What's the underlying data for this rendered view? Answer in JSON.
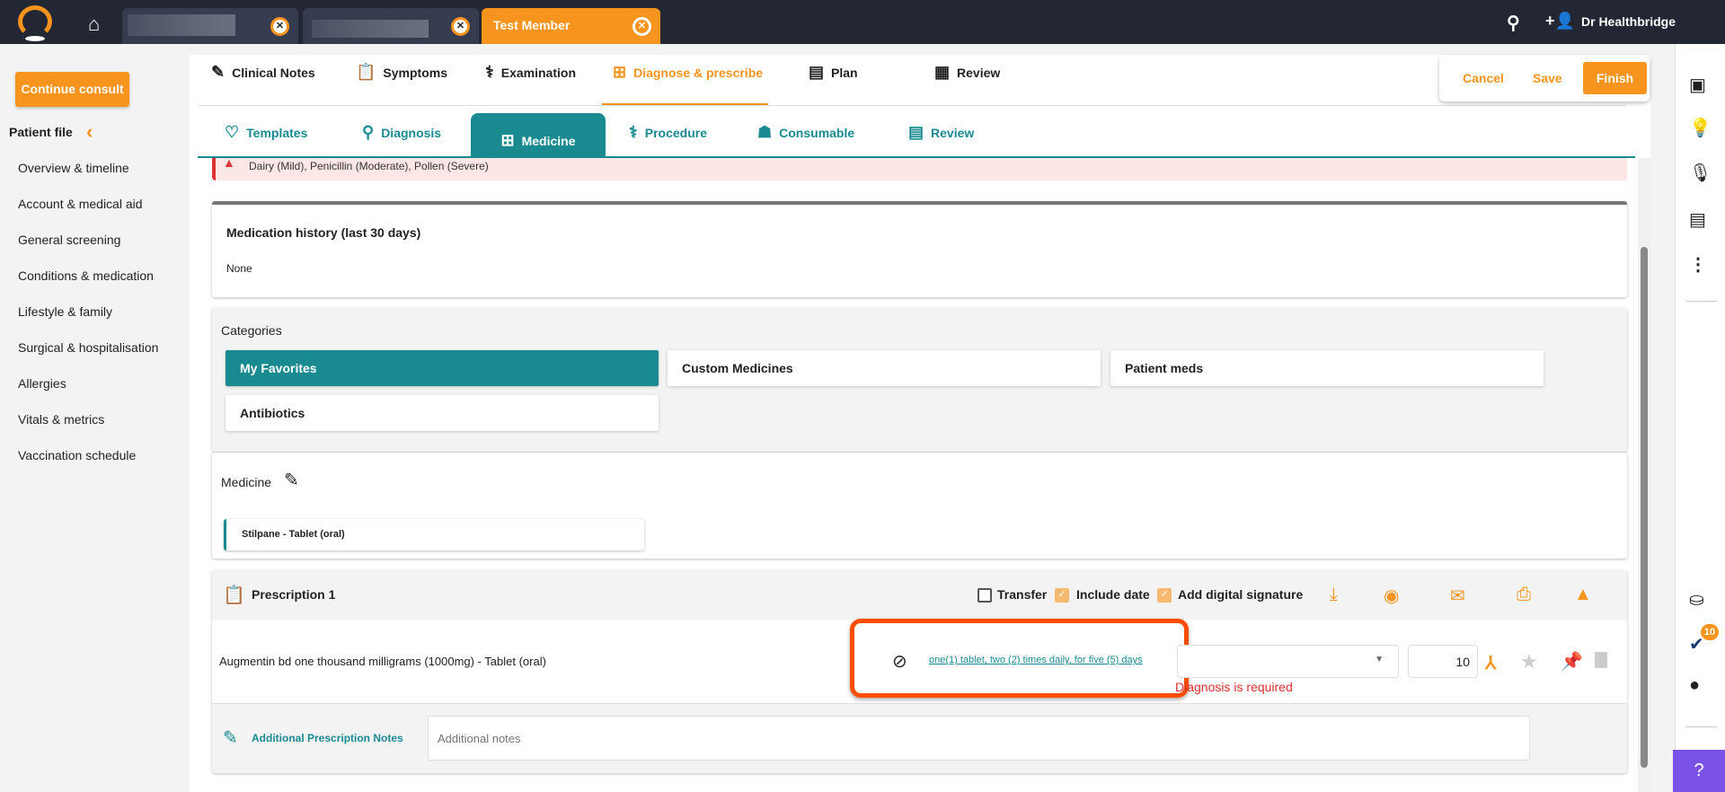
{
  "topbar": {
    "active_tab": "Test Member",
    "user": "Dr Healthbridge"
  },
  "sidebar": {
    "continue": "Continue consult",
    "patient_file": "Patient file",
    "items": [
      "Overview & timeline",
      "Account & medical aid",
      "General screening",
      "Conditions & medication",
      "Lifestyle & family",
      "Surgical & hospitalisation",
      "Allergies",
      "Vitals & metrics",
      "Vaccination schedule"
    ]
  },
  "tabs": {
    "clinical_notes": "Clinical Notes",
    "symptoms": "Symptoms",
    "examination": "Examination",
    "diagnose": "Diagnose & prescribe",
    "plan": "Plan",
    "review": "Review"
  },
  "actions": {
    "cancel": "Cancel",
    "save": "Save",
    "finish": "Finish"
  },
  "subtabs": {
    "templates": "Templates",
    "diagnosis": "Diagnosis",
    "medicine": "Medicine",
    "procedure": "Procedure",
    "consumable": "Consumable",
    "review": "Review"
  },
  "allergies": "Dairy (Mild), Penicillin (Moderate), Pollen (Severe)",
  "med_history": {
    "title": "Medication history (last 30 days)",
    "value": "None"
  },
  "categories": {
    "title": "Categories",
    "items": [
      "My Favorites",
      "Custom Medicines",
      "Patient meds",
      "Antibiotics"
    ]
  },
  "medicine": {
    "title": "Medicine",
    "item": "Stilpane - Tablet (oral)"
  },
  "prescription": {
    "title": "Prescription 1",
    "transfer": "Transfer",
    "include_date": "Include date",
    "signature": "Add digital signature",
    "drug": "Augmentin bd one thousand milligrams (1000mg) - Tablet (oral)",
    "dosage": "one(1) tablet, two (2) times daily, for five (5) days",
    "quantity": "10",
    "error": "Diagnosis is required",
    "notes_label": "Additional Prescription Notes",
    "notes_placeholder": "Additional notes"
  },
  "rail": {
    "badge": "10"
  }
}
